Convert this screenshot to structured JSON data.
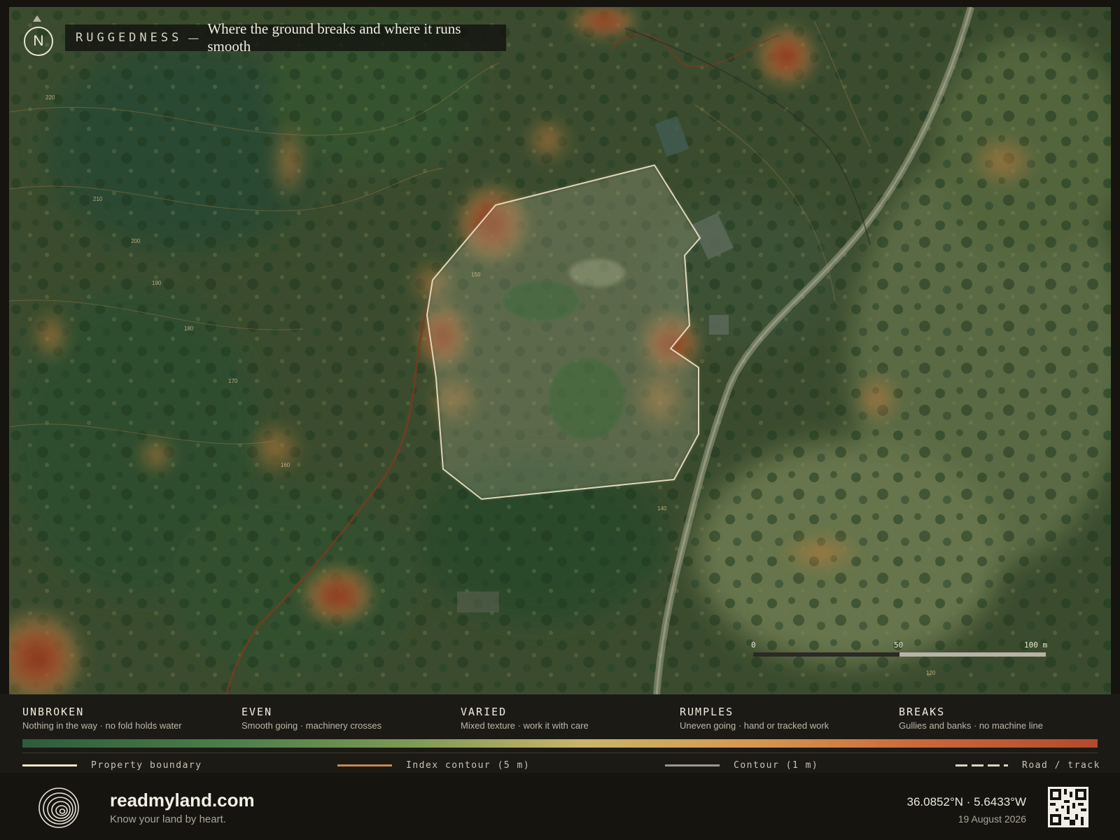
{
  "map": {
    "title_kicker": "RUGGEDNESS",
    "title_separator": "—",
    "title_subtitle": "Where the ground breaks and where it runs smooth",
    "north_label": "N",
    "contour_labels": [
      "220",
      "210",
      "200",
      "190",
      "180",
      "170",
      "160",
      "150",
      "140",
      "120"
    ],
    "scale": {
      "labels": [
        "0",
        "50",
        "100 m"
      ]
    }
  },
  "legend": {
    "classes": [
      {
        "name": "UNBROKEN",
        "desc": "Nothing in the way · no fold holds water"
      },
      {
        "name": "EVEN",
        "desc": "Smooth going · machinery crosses"
      },
      {
        "name": "VARIED",
        "desc": "Mixed texture · work it with care"
      },
      {
        "name": "RUMPLES",
        "desc": "Uneven going · hand or tracked work"
      },
      {
        "name": "BREAKS",
        "desc": "Gullies and banks · no machine line"
      }
    ],
    "ramp_colors": [
      "#2f5b3c",
      "#4a7b49",
      "#7c9a55",
      "#c9b56a",
      "#d59850",
      "#c9673a",
      "#b34a2c"
    ],
    "lines": [
      {
        "label": "Property boundary",
        "color": "#efe6c6"
      },
      {
        "label": "Index contour (5 m)",
        "color": "#c8894e"
      },
      {
        "label": "Contour (1 m)",
        "color": "#9a978c"
      },
      {
        "label": "Road / track",
        "color": "#d9d4c4"
      }
    ]
  },
  "footer": {
    "brand": "readmyland.com",
    "tagline": "Know your land by heart.",
    "coords": "36.0852°N · 5.6433°W",
    "date": "19 August 2026"
  }
}
